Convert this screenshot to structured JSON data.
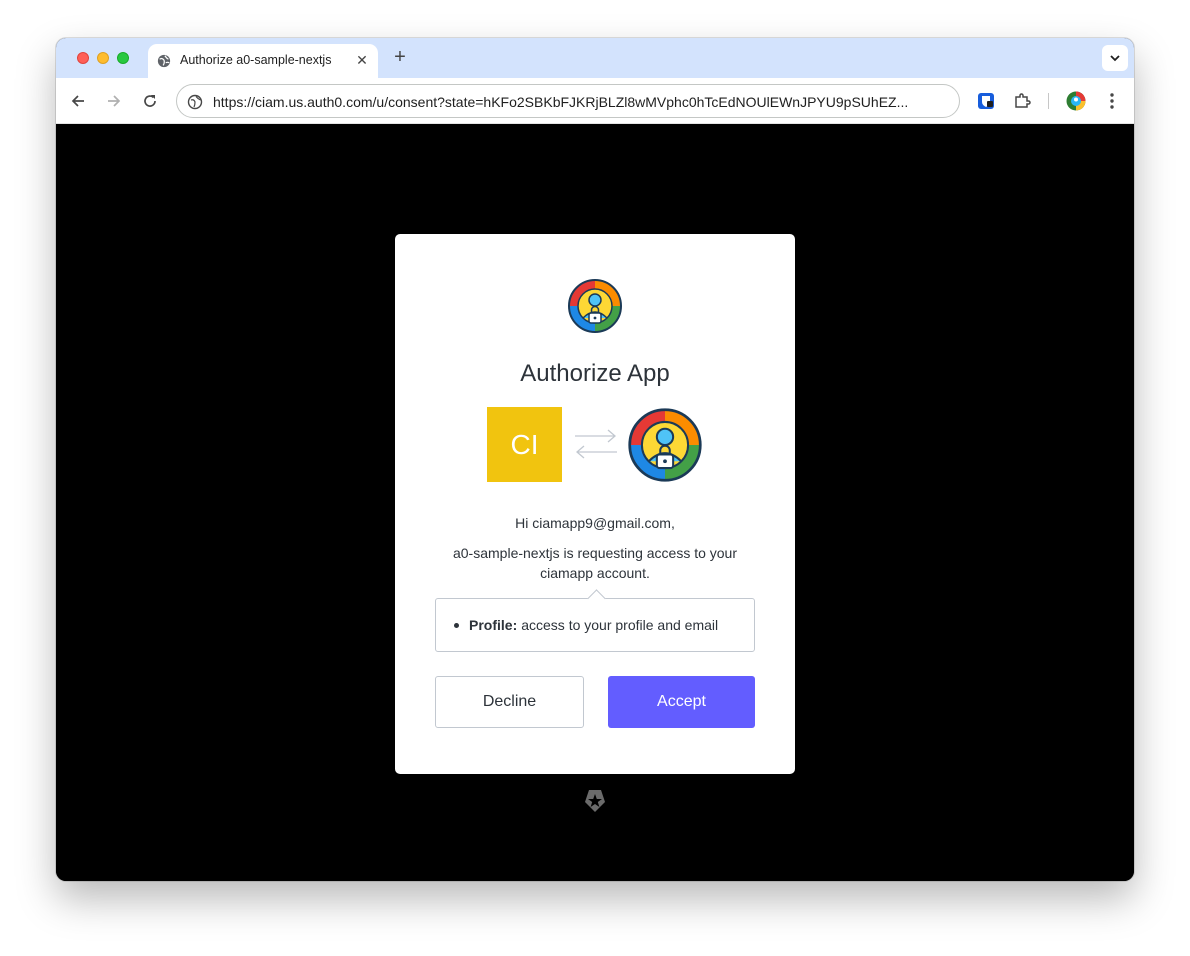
{
  "browser": {
    "tab_title": "Authorize a0-sample-nextjs",
    "tab_close": "✕",
    "new_tab": "+",
    "url": "https://ciam.us.auth0.com/u/consent?state=hKFo2SBKbFJKRjBLZl8wMVphc0hTcEdNOUlEWnJPYU9pSUhEZ..."
  },
  "consent": {
    "title": "Authorize App",
    "app_initials": "CI",
    "greeting": "Hi ciamapp9@gmail.com,",
    "request_text": "a0-sample-nextjs is requesting access to your ciamapp account.",
    "scopes": [
      {
        "name": "Profile:",
        "description": "access to your profile and email"
      }
    ],
    "decline_label": "Decline",
    "accept_label": "Accept"
  },
  "colors": {
    "accent": "#635dff",
    "app_tile": "#f1c40f",
    "tabstrip": "#d3e3fd"
  },
  "icons": [
    "globe-icon",
    "back-arrow-icon",
    "forward-arrow-icon",
    "reload-icon",
    "site-info-icon",
    "bitwarden-icon",
    "extensions-icon",
    "profile-avatar-icon",
    "kebab-menu-icon",
    "chevron-down-icon",
    "swap-arrows-icon",
    "auth0-shield-icon"
  ]
}
